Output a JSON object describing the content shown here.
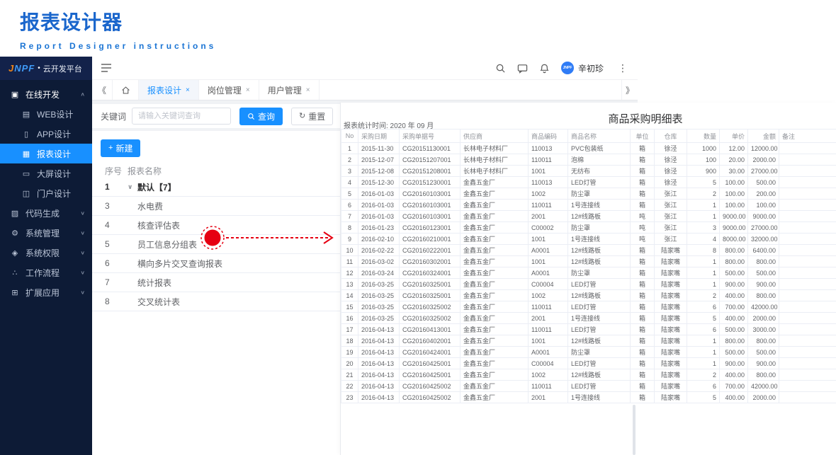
{
  "page_header": {
    "title": "报表设计器",
    "subtitle": "Report Designer instructions"
  },
  "topbar": {
    "logo_brand": "JNPF",
    "logo_dot": "•",
    "logo_platform": "云开发平台",
    "avatar_text": "JNPF",
    "username": "辛初珍"
  },
  "icons": {
    "online-dev-icon": "▣",
    "web-design-icon": "▤",
    "app-design-icon": "▯",
    "report-design-icon": "▦",
    "screen-design-icon": "▭",
    "portal-design-icon": "◫",
    "codegen-icon": "▨",
    "gear-icon": "⚙",
    "shield-icon": "◈",
    "workflow-icon": "∴",
    "apps-grid-icon": "⊞",
    "caret_up": "∧",
    "caret_down": "∨",
    "tree_caret": "∨",
    "collapse_left": "《",
    "expand_right": "》",
    "close": "×",
    "kebab": "⋮",
    "plus": "+",
    "refresh": "↻"
  },
  "sidebar": {
    "items": [
      {
        "label": "在线开发",
        "icon": "online-dev-icon",
        "type": "group",
        "expanded": true,
        "active": false
      },
      {
        "label": "WEB设计",
        "icon": "web-design-icon",
        "type": "child",
        "active": false
      },
      {
        "label": "APP设计",
        "icon": "app-design-icon",
        "type": "child",
        "active": false
      },
      {
        "label": "报表设计",
        "icon": "report-design-icon",
        "type": "child",
        "active": true
      },
      {
        "label": "大屏设计",
        "icon": "screen-design-icon",
        "type": "child",
        "active": false
      },
      {
        "label": "门户设计",
        "icon": "portal-design-icon",
        "type": "child",
        "active": false
      },
      {
        "label": "代码生成",
        "icon": "codegen-icon",
        "type": "group",
        "expanded": false,
        "active": false
      },
      {
        "label": "系统管理",
        "icon": "gear-icon",
        "type": "group",
        "expanded": false,
        "active": false
      },
      {
        "label": "系统权限",
        "icon": "shield-icon",
        "type": "group",
        "expanded": false,
        "active": false
      },
      {
        "label": "工作流程",
        "icon": "workflow-icon",
        "type": "group",
        "expanded": false,
        "active": false
      },
      {
        "label": "扩展应用",
        "icon": "apps-grid-icon",
        "type": "group",
        "expanded": false,
        "active": false
      }
    ]
  },
  "tabs": {
    "items": [
      {
        "label": "报表设计",
        "active": true
      },
      {
        "label": "岗位管理",
        "active": false
      },
      {
        "label": "用户管理",
        "active": false
      }
    ]
  },
  "left_panel": {
    "keyword_label": "关键词",
    "keyword_placeholder": "请输入关键词查询",
    "search_button": "查询",
    "reset_button": "重置",
    "new_button": "新建",
    "columns": {
      "no": "序号",
      "name": "报表名称"
    },
    "rows": [
      {
        "no": "1",
        "name": "默认【7】",
        "group": true
      },
      {
        "no": "3",
        "name": "水电费",
        "group": false
      },
      {
        "no": "4",
        "name": "核查评估表",
        "group": false
      },
      {
        "no": "5",
        "name": "员工信息分组表",
        "group": false
      },
      {
        "no": "6",
        "name": "横向多片交叉查询报表",
        "group": false
      },
      {
        "no": "7",
        "name": "统计报表",
        "group": false
      },
      {
        "no": "8",
        "name": "交叉统计表",
        "group": false
      }
    ]
  },
  "report_preview": {
    "stat_label": "报表统计时间: 2020 年 09 月",
    "title": "商品采购明细表",
    "columns": [
      "No",
      "采购日期",
      "采购单据号",
      "供应商",
      "商品编码",
      "商品名称",
      "单位",
      "仓库",
      "数量",
      "单价",
      "金额",
      "备注"
    ],
    "rows": [
      [
        "1",
        "2015-11-30",
        "CG20151130001",
        "长林电子材料厂",
        "110013",
        "PVC包装纸",
        "箱",
        "徐泾",
        "1000",
        "12.00",
        "12000.00",
        ""
      ],
      [
        "2",
        "2015-12-07",
        "CG20151207001",
        "长林电子材料厂",
        "110011",
        "泡棉",
        "箱",
        "徐泾",
        "100",
        "20.00",
        "2000.00",
        ""
      ],
      [
        "3",
        "2015-12-08",
        "CG20151208001",
        "长林电子材料厂",
        "1001",
        "无纺布",
        "箱",
        "徐泾",
        "900",
        "30.00",
        "27000.00",
        ""
      ],
      [
        "4",
        "2015-12-30",
        "CG20151230001",
        "金鑫五金厂",
        "110013",
        "LED灯管",
        "箱",
        "徐泾",
        "5",
        "100.00",
        "500.00",
        ""
      ],
      [
        "5",
        "2016-01-03",
        "CG20160103001",
        "金鑫五金厂",
        "1002",
        "防尘罩",
        "箱",
        "张江",
        "2",
        "100.00",
        "200.00",
        ""
      ],
      [
        "6",
        "2016-01-03",
        "CG20160103001",
        "金鑫五金厂",
        "110011",
        "1号连接线",
        "箱",
        "张江",
        "1",
        "100.00",
        "100.00",
        ""
      ],
      [
        "7",
        "2016-01-03",
        "CG20160103001",
        "金鑫五金厂",
        "2001",
        "12#线路板",
        "吨",
        "张江",
        "1",
        "9000.00",
        "9000.00",
        ""
      ],
      [
        "8",
        "2016-01-23",
        "CG20160123001",
        "金鑫五金厂",
        "C00002",
        "防尘罩",
        "吨",
        "张江",
        "3",
        "9000.00",
        "27000.00",
        ""
      ],
      [
        "9",
        "2016-02-10",
        "CG20160210001",
        "金鑫五金厂",
        "1001",
        "1号连接线",
        "吨",
        "张江",
        "4",
        "8000.00",
        "32000.00",
        ""
      ],
      [
        "10",
        "2016-02-22",
        "CG20160222001",
        "金鑫五金厂",
        "A0001",
        "12#线路板",
        "箱",
        "陆家嘴",
        "8",
        "800.00",
        "6400.00",
        ""
      ],
      [
        "11",
        "2016-03-02",
        "CG20160302001",
        "金鑫五金厂",
        "1001",
        "12#线路板",
        "箱",
        "陆家嘴",
        "1",
        "800.00",
        "800.00",
        ""
      ],
      [
        "12",
        "2016-03-24",
        "CG20160324001",
        "金鑫五金厂",
        "A0001",
        "防尘罩",
        "箱",
        "陆家嘴",
        "1",
        "500.00",
        "500.00",
        ""
      ],
      [
        "13",
        "2016-03-25",
        "CG20160325001",
        "金鑫五金厂",
        "C00004",
        "LED灯管",
        "箱",
        "陆家嘴",
        "1",
        "900.00",
        "900.00",
        ""
      ],
      [
        "14",
        "2016-03-25",
        "CG20160325001",
        "金鑫五金厂",
        "1002",
        "12#线路板",
        "箱",
        "陆家嘴",
        "2",
        "400.00",
        "800.00",
        ""
      ],
      [
        "15",
        "2016-03-25",
        "CG20160325002",
        "金鑫五金厂",
        "110011",
        "LED灯管",
        "箱",
        "陆家嘴",
        "6",
        "700.00",
        "42000.00",
        ""
      ],
      [
        "16",
        "2016-03-25",
        "CG20160325002",
        "金鑫五金厂",
        "2001",
        "1号连接线",
        "箱",
        "陆家嘴",
        "5",
        "400.00",
        "2000.00",
        ""
      ],
      [
        "17",
        "2016-04-13",
        "CG20160413001",
        "金鑫五金厂",
        "110011",
        "LED灯管",
        "箱",
        "陆家嘴",
        "6",
        "500.00",
        "3000.00",
        ""
      ],
      [
        "18",
        "2016-04-13",
        "CG20160402001",
        "金鑫五金厂",
        "1001",
        "12#线路板",
        "箱",
        "陆家嘴",
        "1",
        "800.00",
        "800.00",
        ""
      ],
      [
        "19",
        "2016-04-13",
        "CG20160424001",
        "金鑫五金厂",
        "A0001",
        "防尘罩",
        "箱",
        "陆家嘴",
        "1",
        "500.00",
        "500.00",
        ""
      ],
      [
        "20",
        "2016-04-13",
        "CG20160425001",
        "金鑫五金厂",
        "C00004",
        "LED灯管",
        "箱",
        "陆家嘴",
        "1",
        "900.00",
        "900.00",
        ""
      ],
      [
        "21",
        "2016-04-13",
        "CG20160425001",
        "金鑫五金厂",
        "1002",
        "12#线路板",
        "箱",
        "陆家嘴",
        "2",
        "400.00",
        "800.00",
        ""
      ],
      [
        "22",
        "2016-04-13",
        "CG20160425002",
        "金鑫五金厂",
        "110011",
        "LED灯管",
        "箱",
        "陆家嘴",
        "6",
        "700.00",
        "42000.00",
        ""
      ],
      [
        "23",
        "2016-04-13",
        "CG20160425002",
        "金鑫五金厂",
        "2001",
        "1号连接线",
        "箱",
        "陆家嘴",
        "5",
        "400.00",
        "2000.00",
        ""
      ]
    ]
  },
  "annotation": {
    "color": "#e60012"
  },
  "colors": {
    "primary": "#1890ff",
    "sidebar_bg": "#0d1b36",
    "content_bg": "#f0f2f5",
    "border": "#ebeef5"
  }
}
